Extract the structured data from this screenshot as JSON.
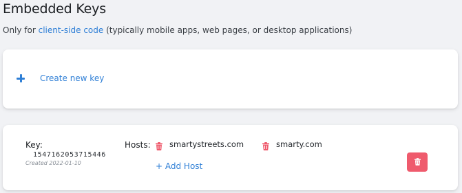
{
  "header": {
    "title": "Embedded Keys",
    "subtitle_prefix": "Only for ",
    "subtitle_link": "client-side code",
    "subtitle_suffix": " (typically mobile apps, web pages, or desktop applications)"
  },
  "create": {
    "label": "Create new key",
    "icon": "plus-icon"
  },
  "key": {
    "label": "Key:",
    "value": "1547162053715446",
    "created": "Created 2022-01-10",
    "hosts_label": "Hosts:",
    "hosts": [
      {
        "name": "smartystreets.com",
        "icon": "trash-icon"
      },
      {
        "name": "smarty.com",
        "icon": "trash-icon"
      }
    ],
    "add_host_label": "+ Add Host",
    "delete_icon": "trash-icon"
  },
  "colors": {
    "accent": "#2f7fd6",
    "danger": "#ef5b6d",
    "background": "#f1f2f5",
    "card": "#ffffff"
  }
}
